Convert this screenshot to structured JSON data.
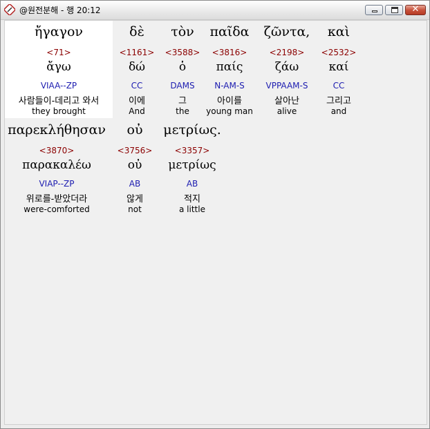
{
  "window": {
    "title": "@원전분해 - 행 20:12"
  },
  "verse_lines": [
    {
      "words": [
        {
          "greek": "ἤγαγον",
          "strong": "<71>",
          "lemma": "ἄγω",
          "parsing": "VIAA--ZP",
          "korean": "사람들이-데리고 와서",
          "english": "they brought",
          "selected": true
        },
        {
          "greek": "δὲ",
          "strong": "<1161>",
          "lemma": "δώ",
          "parsing": "CC",
          "korean": "이에",
          "english": "And"
        },
        {
          "greek": "τὸν",
          "strong": "<3588>",
          "lemma": "ὁ",
          "parsing": "DAMS",
          "korean": "그",
          "english": "the"
        },
        {
          "greek": "παῖδα",
          "strong": "<3816>",
          "lemma": "παίς",
          "parsing": "N-AM-S",
          "korean": "아이를",
          "english": "young man"
        },
        {
          "greek": "ζῶντα,",
          "strong": "<2198>",
          "lemma": "ζάω",
          "parsing": "VPPAAM-S",
          "korean": "살아난",
          "english": "alive"
        },
        {
          "greek": "καὶ",
          "strong": "<2532>",
          "lemma": "καί",
          "parsing": "CC",
          "korean": "그리고",
          "english": "and"
        }
      ]
    },
    {
      "words": [
        {
          "greek": "παρεκλήθησαν",
          "strong": "<3870>",
          "lemma": "παρακαλέω",
          "parsing": "VIAP--ZP",
          "korean": "위로를-받았더라",
          "english": "were-comforted"
        },
        {
          "greek": "οὐ",
          "strong": "<3756>",
          "lemma": "οὐ",
          "parsing": "AB",
          "korean": "않게",
          "english": "not"
        },
        {
          "greek": "μετρίως.",
          "strong": "<3357>",
          "lemma": "μετρίως",
          "parsing": "AB",
          "korean": "적지",
          "english": "a little"
        }
      ]
    }
  ],
  "colors": {
    "strong_number": "#8b0000",
    "parsing_code": "#1c1cb0",
    "selected_background": "#ffffff",
    "panel_background": "#f0f0f0"
  },
  "icons": [
    "app-icon",
    "minimize-icon",
    "maximize-icon",
    "close-icon"
  ]
}
